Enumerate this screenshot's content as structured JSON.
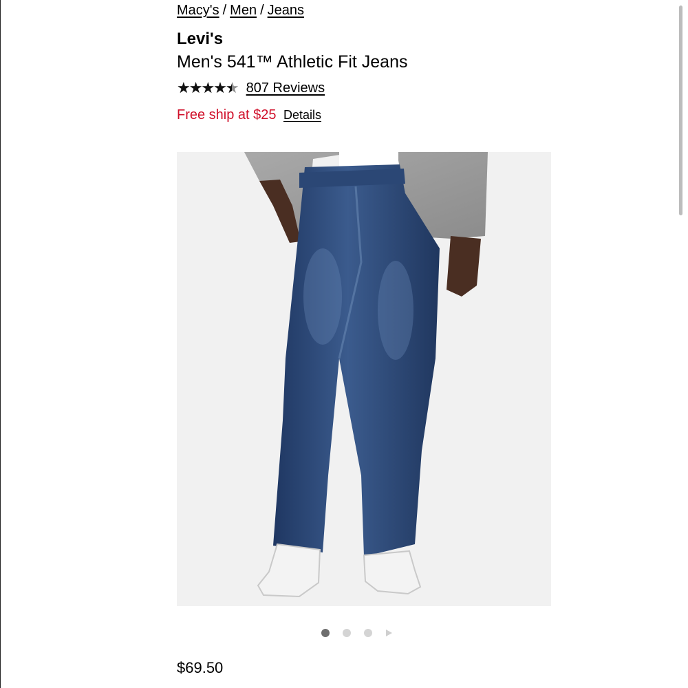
{
  "breadcrumb": {
    "items": [
      "Macy's",
      "Men",
      "Jeans"
    ],
    "separator": "/"
  },
  "product": {
    "brand": "Levi's",
    "title": "Men's 541™ Athletic Fit Jeans",
    "rating": {
      "value": 4.5,
      "max": 5,
      "reviews_label": "807 Reviews"
    },
    "shipping": {
      "text": "Free ship at $25",
      "details_label": "Details"
    },
    "image": {
      "icon": "product-photo-jeans"
    },
    "carousel": {
      "total_dots": 3,
      "active_index": 0,
      "next_icon": "play-arrow-icon"
    },
    "price": "$69.50"
  },
  "colors": {
    "accent_red": "#d0102a",
    "star_filled": "#111111",
    "star_empty": "#8d8d8d",
    "image_background": "#f1f1f1"
  }
}
